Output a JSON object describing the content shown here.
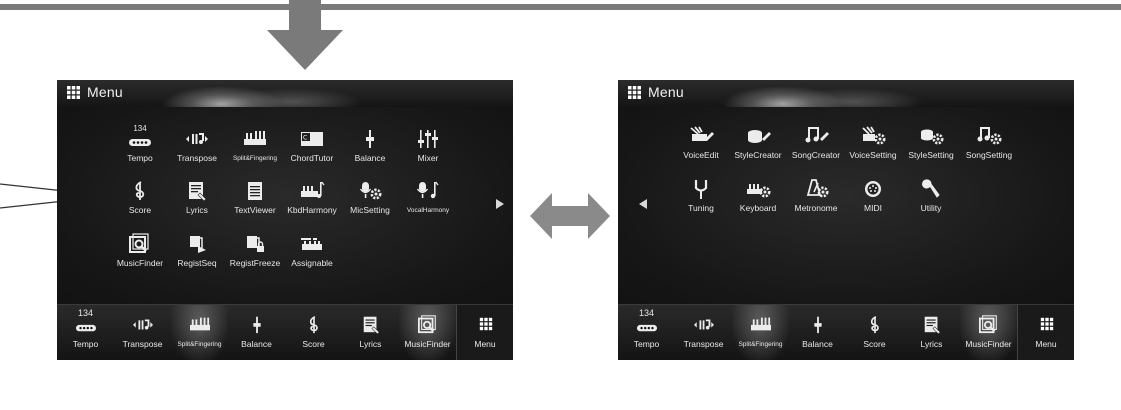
{
  "decor": {
    "frame_color": "#7a7a7a"
  },
  "left_screen": {
    "title": "Menu",
    "page_arrow": "right",
    "rows": [
      [
        {
          "label": "Tempo",
          "icon": "tempo-icon",
          "number": "134"
        },
        {
          "label": "Transpose",
          "icon": "transpose-icon"
        },
        {
          "label": "Split&Fingering",
          "icon": "split-fingering-icon",
          "tiny": true
        },
        {
          "label": "ChordTutor",
          "icon": "chord-tutor-icon"
        },
        {
          "label": "Balance",
          "icon": "balance-icon"
        },
        {
          "label": "Mixer",
          "icon": "mixer-icon"
        }
      ],
      [
        {
          "label": "Score",
          "icon": "score-icon"
        },
        {
          "label": "Lyrics",
          "icon": "lyrics-icon"
        },
        {
          "label": "TextViewer",
          "icon": "text-viewer-icon"
        },
        {
          "label": "KbdHarmony",
          "icon": "kbd-harmony-icon"
        },
        {
          "label": "MicSetting",
          "icon": "mic-setting-icon"
        },
        {
          "label": "VocalHarmony",
          "icon": "vocal-harmony-icon",
          "tiny": true
        }
      ],
      [
        {
          "label": "MusicFinder",
          "icon": "music-finder-icon"
        },
        {
          "label": "RegistSeq",
          "icon": "regist-seq-icon"
        },
        {
          "label": "RegistFreeze",
          "icon": "regist-freeze-icon"
        },
        {
          "label": "Assignable",
          "icon": "assignable-icon"
        }
      ]
    ]
  },
  "right_screen": {
    "title": "Menu",
    "page_arrow": "left",
    "rows": [
      [
        {
          "label": "VoiceEdit",
          "icon": "voice-edit-icon"
        },
        {
          "label": "StyleCreator",
          "icon": "style-creator-icon"
        },
        {
          "label": "SongCreator",
          "icon": "song-creator-icon"
        },
        {
          "label": "VoiceSetting",
          "icon": "voice-setting-icon"
        },
        {
          "label": "StyleSetting",
          "icon": "style-setting-icon"
        },
        {
          "label": "SongSetting",
          "icon": "song-setting-icon"
        }
      ],
      [
        {
          "label": "Tuning",
          "icon": "tuning-icon"
        },
        {
          "label": "Keyboard",
          "icon": "keyboard-icon"
        },
        {
          "label": "Metronome",
          "icon": "metronome-icon"
        },
        {
          "label": "MIDI",
          "icon": "midi-icon"
        },
        {
          "label": "Utility",
          "icon": "utility-icon"
        }
      ]
    ]
  },
  "bottom_bar": [
    {
      "label": "Tempo",
      "icon": "tempo-icon",
      "number": "134"
    },
    {
      "label": "Transpose",
      "icon": "transpose-icon"
    },
    {
      "label": "Split&Fingering",
      "icon": "split-fingering-icon",
      "tiny": true,
      "highlight": true
    },
    {
      "label": "Balance",
      "icon": "balance-icon"
    },
    {
      "label": "Score",
      "icon": "score-icon"
    },
    {
      "label": "Lyrics",
      "icon": "lyrics-icon"
    },
    {
      "label": "MusicFinder",
      "icon": "music-finder-icon",
      "highlight": true
    },
    {
      "label": "Menu",
      "icon": "menu-grid-icon"
    }
  ]
}
